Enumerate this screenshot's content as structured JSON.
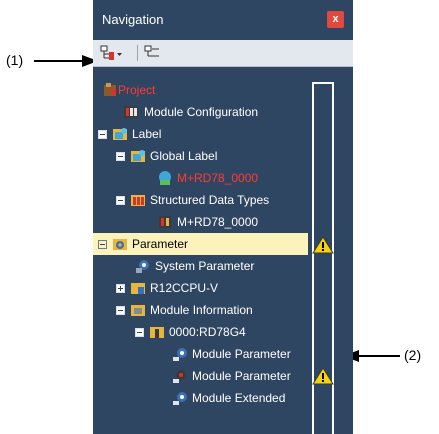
{
  "callouts": {
    "left": "(1)",
    "right": "(2)"
  },
  "window": {
    "title": "Navigation",
    "close_glyph": "x"
  },
  "toolbar": {
    "buttons": [
      {
        "icon": "tree-view-dropdown-icon"
      },
      {
        "icon": "collapse-tree-icon"
      }
    ]
  },
  "tree": [
    {
      "label": "Project",
      "icon": "project-icon",
      "red": true
    },
    {
      "label": "Module Configuration",
      "icon": "module-configuration-icon"
    },
    {
      "label": "Label",
      "icon": "label-folder-icon",
      "expander": "minus"
    },
    {
      "label": "Global Label",
      "icon": "label-folder-icon",
      "expander": "minus"
    },
    {
      "label": "M+RD78_0000",
      "icon": "global-label-item-icon",
      "red": true
    },
    {
      "label": "Structured Data Types",
      "icon": "structured-data-icon",
      "expander": "minus"
    },
    {
      "label": "M+RD78_0000",
      "icon": "structured-data-item-icon"
    },
    {
      "label": "Parameter",
      "icon": "parameter-folder-icon",
      "expander": "minus",
      "selected": true,
      "warning": true
    },
    {
      "label": "System Parameter",
      "icon": "system-parameter-icon"
    },
    {
      "label": "R12CCPU-V",
      "icon": "cpu-parameter-icon",
      "expander": "plus"
    },
    {
      "label": "Module Information",
      "icon": "module-info-folder-icon",
      "expander": "minus"
    },
    {
      "label": "0000:RD78G4",
      "icon": "module-icon",
      "expander": "minus"
    },
    {
      "label": "Module Parameter",
      "icon": "module-parameter-icon"
    },
    {
      "label": "Module Parameter",
      "icon": "module-parameter-icon",
      "warning": true
    },
    {
      "label": "Module Extended",
      "icon": "module-extended-icon"
    }
  ]
}
